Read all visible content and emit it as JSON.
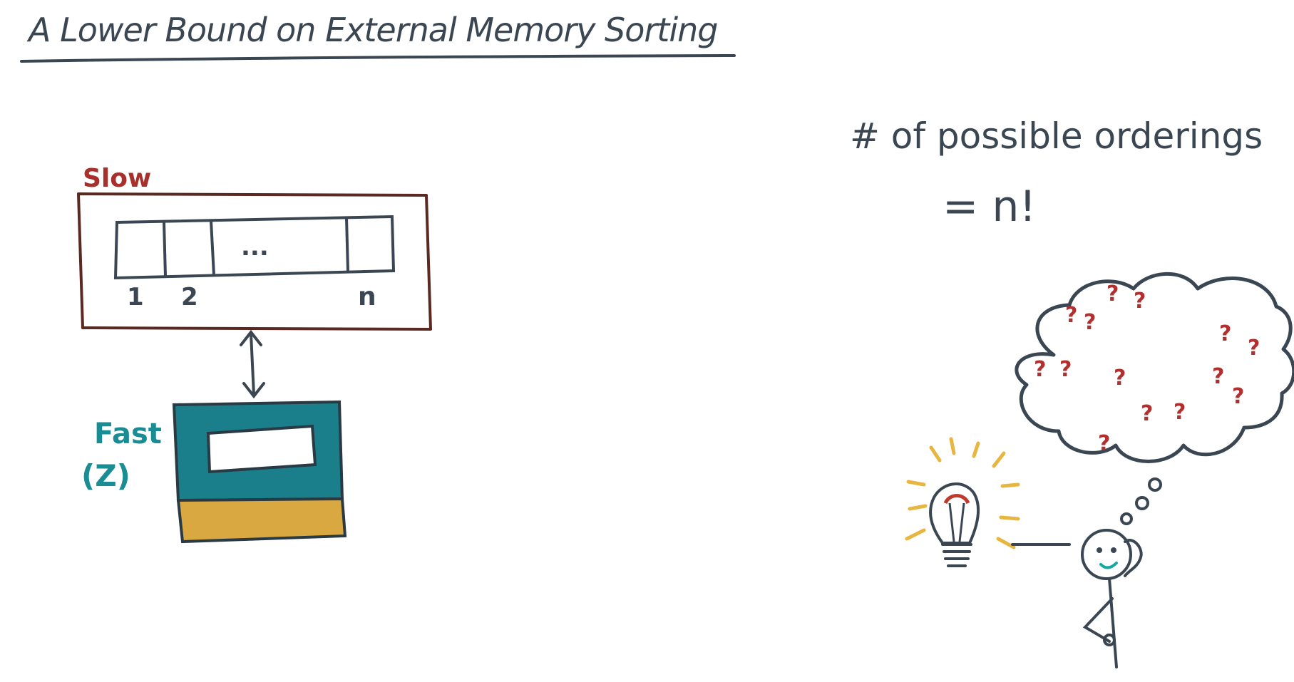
{
  "title": "A Lower Bound on External Memory Sorting",
  "slow_memory": {
    "label": "Slow",
    "cells": [
      "1",
      "2",
      "...",
      "n"
    ]
  },
  "fast_memory": {
    "label": "Fast",
    "size_label": "(Z)"
  },
  "orderings": {
    "line1": "# of possible orderings",
    "line2": "= n!"
  },
  "thought_marks": "?",
  "colors": {
    "ink": "#3a4652",
    "slow_box": "#5a2a22",
    "slow_label": "#a8302c",
    "fast_label": "#1a8c93",
    "fast_teal": "#1a7f8a",
    "fast_gold": "#d9a841",
    "question_red": "#b03030",
    "bulb_yellow": "#e6b640",
    "face_teal": "#17a9a0"
  }
}
